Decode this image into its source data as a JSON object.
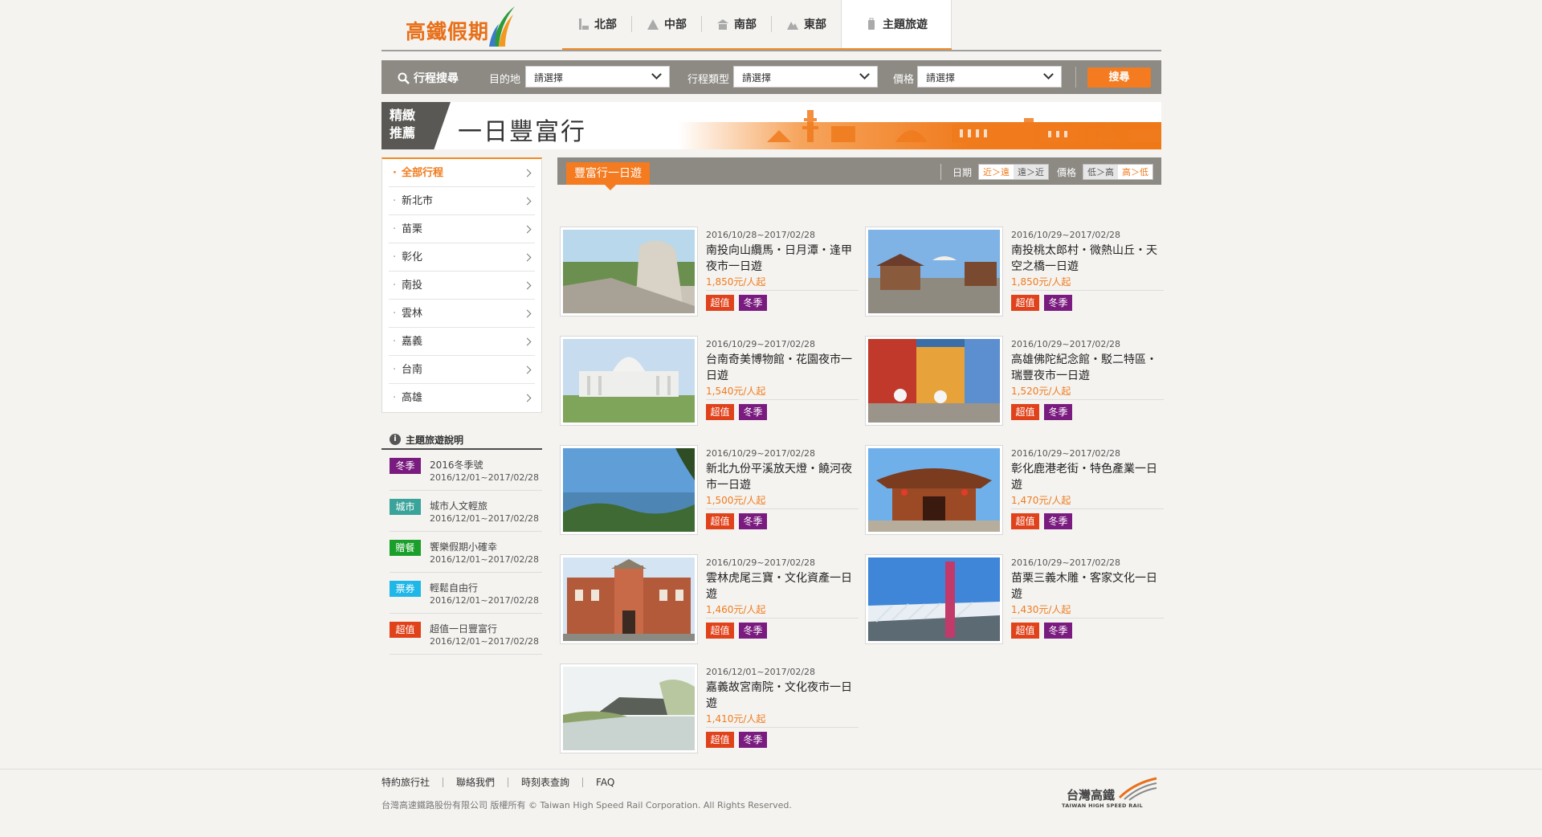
{
  "header": {
    "logo_text": "高鐵假期",
    "nav": [
      {
        "label": "北部",
        "icon": "building-icon"
      },
      {
        "label": "中部",
        "icon": "mountain-icon"
      },
      {
        "label": "南部",
        "icon": "temple-icon"
      },
      {
        "label": "東部",
        "icon": "hill-icon"
      },
      {
        "label": "主題旅遊",
        "icon": "suitcase-icon"
      }
    ]
  },
  "search": {
    "title": "行程搜尋",
    "destination_label": "目的地",
    "destination_value": "請選擇",
    "type_label": "行程類型",
    "type_value": "請選擇",
    "price_label": "價格",
    "price_value": "請選擇",
    "button": "搜尋"
  },
  "banner": {
    "tag": [
      "精緻",
      "推薦"
    ],
    "title": "一日豐富行"
  },
  "sidebar": {
    "categories": [
      "全部行程",
      "新北市",
      "苗栗",
      "彰化",
      "南投",
      "雲林",
      "嘉義",
      "台南",
      "高雄"
    ],
    "theme_title": "主題旅遊說明",
    "themes": [
      {
        "badge": "冬季",
        "color": "#7a1b7f",
        "name": "2016冬季號",
        "date": "2016/12/01~2017/02/28"
      },
      {
        "badge": "城市",
        "color": "#3aa39a",
        "name": "城市人文輕旅",
        "date": "2016/12/01~2017/02/28"
      },
      {
        "badge": "贈餐",
        "color": "#1aa02a",
        "name": "饗樂假期小確幸",
        "date": "2016/12/01~2017/02/28"
      },
      {
        "badge": "票券",
        "color": "#1fb7e8",
        "name": "輕鬆自由行",
        "date": "2016/12/01~2017/02/28"
      },
      {
        "badge": "超值",
        "color": "#e0421b",
        "name": "超值一日豐富行",
        "date": "2016/12/01~2017/02/28"
      }
    ]
  },
  "main": {
    "tab": "豐富行一日遊",
    "date_label": "日期",
    "date_opts": [
      "近＞遠",
      "遠＞近"
    ],
    "price_label": "價格",
    "price_opts": [
      "低＞高",
      "高＞低"
    ],
    "tours": [
      {
        "date": "2016/10/28~2017/02/28",
        "title": "南投向山纜馬・日月潭・逢甲夜市一日遊",
        "price": "1,850元/人起",
        "tags": [
          "超值",
          "冬季"
        ]
      },
      {
        "date": "2016/10/29~2017/02/28",
        "title": "南投桃太郎村・微熱山丘・天空之橋一日遊",
        "price": "1,850元/人起",
        "tags": [
          "超值",
          "冬季"
        ]
      },
      {
        "date": "2016/10/29~2017/02/28",
        "title": "台南奇美博物館・花園夜市一日遊",
        "price": "1,540元/人起",
        "tags": [
          "超值",
          "冬季"
        ]
      },
      {
        "date": "2016/10/29~2017/02/28",
        "title": "高雄佛陀紀念館・駁二特區・瑞豐夜市一日遊",
        "price": "1,520元/人起",
        "tags": [
          "超值",
          "冬季"
        ]
      },
      {
        "date": "2016/10/29~2017/02/28",
        "title": "新北九份平溪放天燈・饒河夜市一日遊",
        "price": "1,500元/人起",
        "tags": [
          "超值",
          "冬季"
        ]
      },
      {
        "date": "2016/10/29~2017/02/28",
        "title": "彰化鹿港老街・特色產業一日遊",
        "price": "1,470元/人起",
        "tags": [
          "超值",
          "冬季"
        ]
      },
      {
        "date": "2016/10/29~2017/02/28",
        "title": "雲林虎尾三寶・文化資產一日遊",
        "price": "1,460元/人起",
        "tags": [
          "超值",
          "冬季"
        ]
      },
      {
        "date": "2016/10/29~2017/02/28",
        "title": "苗栗三義木雕・客家文化一日遊",
        "price": "1,430元/人起",
        "tags": [
          "超值",
          "冬季"
        ]
      },
      {
        "date": "2016/12/01~2017/02/28",
        "title": "嘉義故宮南院・文化夜市一日遊",
        "price": "1,410元/人起",
        "tags": [
          "超值",
          "冬季"
        ]
      }
    ]
  },
  "footer": {
    "links": [
      "特約旅行社",
      "聯絡我們",
      "時刻表查詢",
      "FAQ"
    ],
    "copyright": "台灣高速鐵路股份有限公司 版權所有 © Taiwan High Speed Rail Corporation. All Rights Reserved.",
    "logo_cn": "台灣高鐵",
    "logo_en": "TAIWAN HIGH SPEED RAIL"
  },
  "colors": {
    "accent": "#f47b20",
    "bar": "#8d8a84",
    "winter": "#7a1b7f",
    "value": "#e0421b"
  }
}
